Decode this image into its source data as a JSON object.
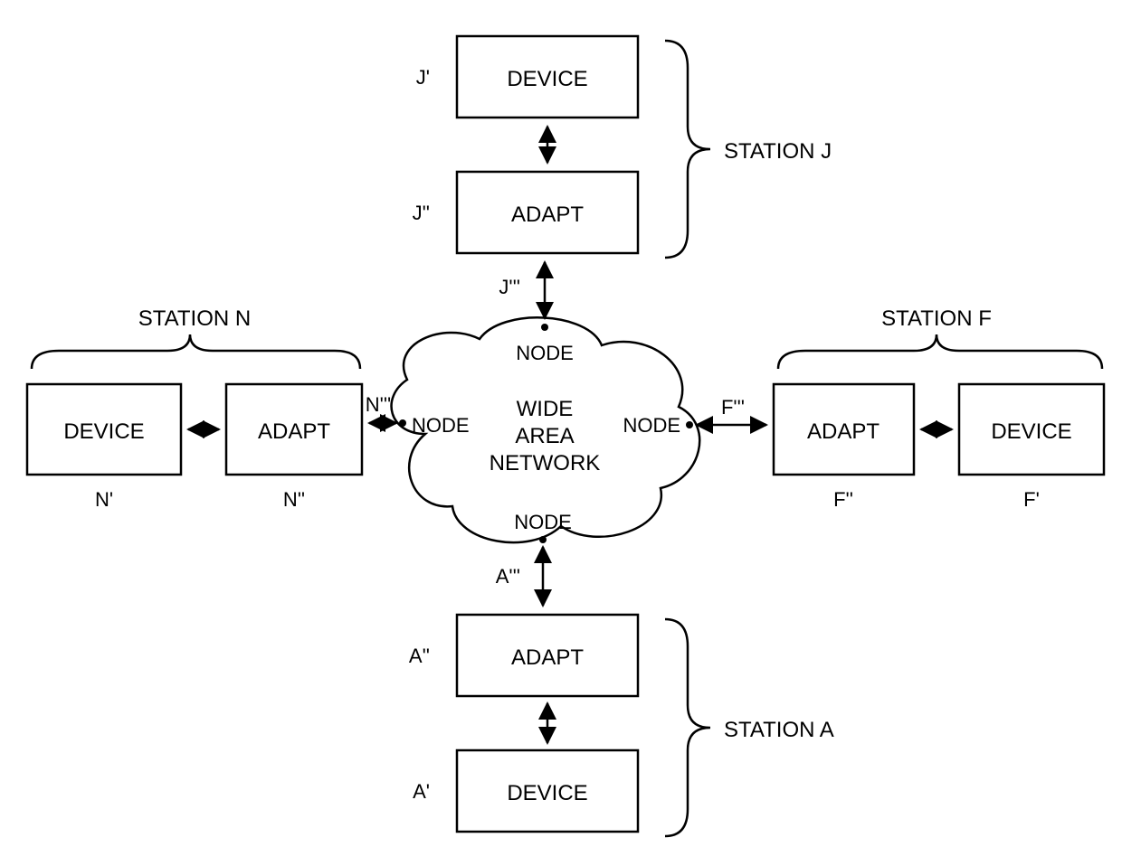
{
  "center": {
    "title_l1": "WIDE",
    "title_l2": "AREA",
    "title_l3": "NETWORK",
    "node_top": "NODE",
    "node_left": "NODE",
    "node_right": "NODE",
    "node_bottom": "NODE"
  },
  "stations": {
    "J": {
      "label": "STATION J",
      "device": "DEVICE",
      "adapt": "ADAPT",
      "p1": "J'",
      "p2": "J''",
      "p3": "J'''"
    },
    "N": {
      "label": "STATION  N",
      "device": "DEVICE",
      "adapt": "ADAPT",
      "p1": "N'",
      "p2": "N''",
      "p3": "N'''"
    },
    "F": {
      "label": "STATION F",
      "device": "DEVICE",
      "adapt": "ADAPT",
      "p1": "F'",
      "p2": "F''",
      "p3": "F'''"
    },
    "A": {
      "label": "STATION A",
      "device": "DEVICE",
      "adapt": "ADAPT",
      "p1": "A'",
      "p2": "A''",
      "p3": "A'''"
    }
  }
}
